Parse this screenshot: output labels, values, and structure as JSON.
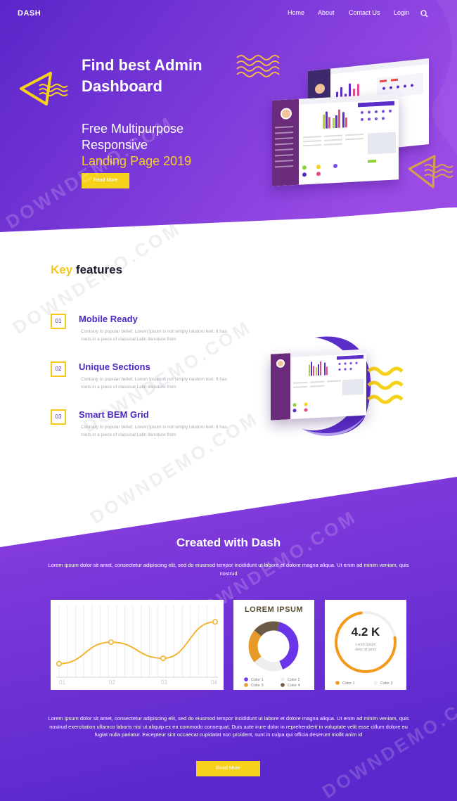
{
  "nav": {
    "logo": "DASH",
    "items": [
      "Home",
      "About",
      "Contact Us",
      "Login"
    ],
    "search_icon": "search-icon"
  },
  "hero": {
    "title": "Find best Admin Dashboard",
    "sub_line1": "Free Multipurpose",
    "sub_line2": "Responsive",
    "sub_line3": "Landing Page 2019",
    "button": "Read More"
  },
  "features": {
    "title_accent": "Key",
    "title_rest": " features",
    "items": [
      {
        "num": "01",
        "title": "Mobile Ready",
        "desc": "Contrary to popular belief, Lorem Ipsum is not simply random text. It has roots in a piece of classical Latin literature from"
      },
      {
        "num": "02",
        "title": "Unique Sections",
        "desc": "Contrary to popular belief, Lorem Ipsum is not simply random text. It has roots in a piece of classical Latin literature from"
      },
      {
        "num": "03",
        "title": "Smart BEM Grid",
        "desc": "Contrary to popular belief, Lorem Ipsum is not simply random text. It has roots in a piece of classical Latin literature from"
      }
    ]
  },
  "created": {
    "title": "Created with Dash",
    "desc": "Lorem ipsum dolor sit amet, consectetur adipiscing elit, sed do eiusmod tempor incididunt ut labore et dolore magna aliqua. Ut enim ad minim veniam, quis nostrud",
    "bottom_desc": "Lorem ipsum dolor sit amet, consectetur adipiscing elit, sed do eiusmod tempor incididunt ut labore et dolore magna aliqua. Ut enim ad minim veniam, quis nostrud exercitation ullamco laboris nisi ut aliquip ex ea commodo consequat. Duis aute irure dolor in reprehenderit in voluptate velit esse cillum dolore eu fugiat nulla pariatur. Excepteur sint occaecat cupidatat non proident, sunt in culpa qui officia deserunt mollit anim id",
    "button": "Read More"
  },
  "chart_data": [
    {
      "type": "line",
      "categories": [
        "01",
        "02",
        "03",
        "04"
      ],
      "series": [
        {
          "values": [
            1,
            2.6,
            1.4,
            4.1
          ]
        }
      ],
      "ylim": [
        0,
        5
      ],
      "grid": true
    },
    {
      "type": "pie",
      "title": "LOREM IPSUM",
      "categories": [
        "Color 1",
        "Color 2",
        "Color 3",
        "Color 4"
      ],
      "values": [
        40,
        20,
        22,
        18
      ],
      "colors": [
        "#6a35e8",
        "#eeeeee",
        "#e59a2a",
        "#6a5a45"
      ]
    },
    {
      "type": "pie",
      "title": "4.2 K",
      "subtitle": "Lorem ipsum dolor sit amet",
      "categories": [
        "Color 1",
        "Color 2"
      ],
      "values": [
        75,
        25
      ],
      "colors": [
        "#f39a1a",
        "#f0f0f0"
      ]
    }
  ],
  "colors": {
    "accent_yellow": "#f7d21b",
    "purple": "#5b2ec9",
    "heading": "#4f27c4"
  },
  "watermark": "DOWNDEMO.COM"
}
